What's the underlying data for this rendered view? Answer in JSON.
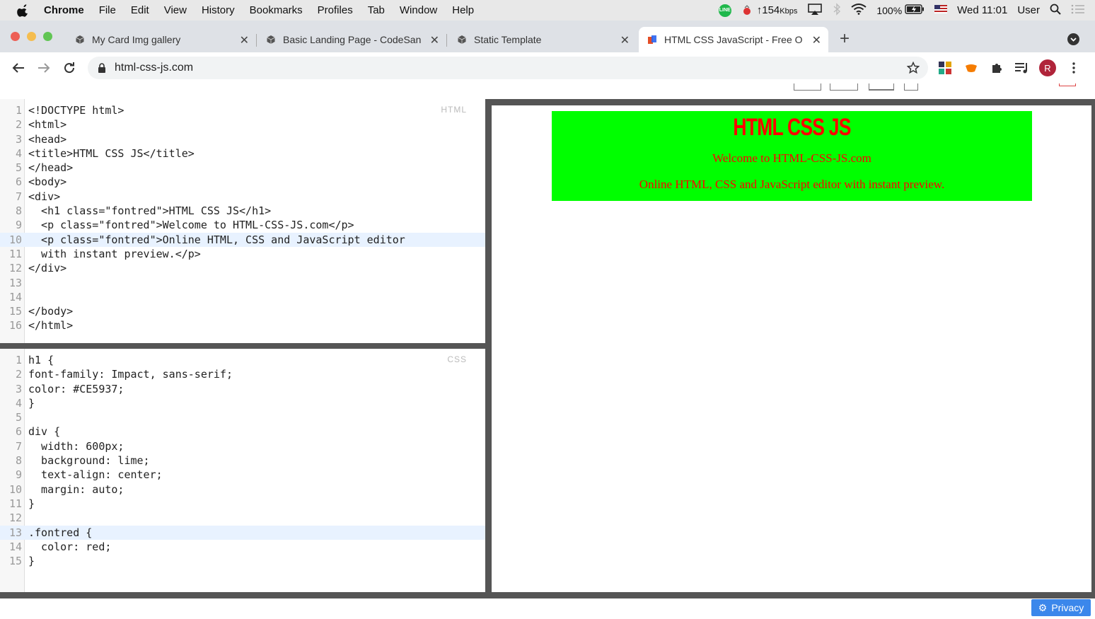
{
  "os_menubar": {
    "app_name": "Chrome",
    "items": [
      "File",
      "Edit",
      "View",
      "History",
      "Bookmarks",
      "Profiles",
      "Tab",
      "Window",
      "Help"
    ],
    "status": {
      "line_icon_text": "LINE",
      "network": "↑154",
      "network_unit": "Kbps",
      "battery": "100%",
      "datetime": "Wed 11:01",
      "user": "User"
    }
  },
  "browser": {
    "tabs": [
      {
        "title": "My Card Img gallery"
      },
      {
        "title": "Basic Landing Page - CodeSan"
      },
      {
        "title": "Static Template"
      },
      {
        "title": "HTML CSS JavaScript - Free O"
      }
    ],
    "url": "html-css-js.com",
    "profile_initial": "R"
  },
  "html_editor": {
    "lang_label": "HTML",
    "lines": [
      "<!DOCTYPE html>",
      "<html>",
      "<head>",
      "<title>HTML CSS JS</title>",
      "</head>",
      "<body>",
      "<div>",
      "  <h1 class=\"fontred\">HTML CSS JS</h1>",
      "  <p class=\"fontred\">Welcome to HTML-CSS-JS.com</p>",
      "  <p class=\"fontred\">Online HTML, CSS and JavaScript editor",
      "  with instant preview.</p>",
      "</div>",
      "",
      "",
      "</body>",
      "</html>"
    ]
  },
  "css_editor": {
    "lang_label": "CSS",
    "lines": [
      "h1 {",
      "font-family: Impact, sans-serif;",
      "color: #CE5937;",
      "}",
      "",
      "div {",
      "  width: 600px;",
      "  background: lime;",
      "  text-align: center;",
      "  margin: auto;",
      "}",
      "",
      ".fontred {",
      "  color: red;",
      "}"
    ]
  },
  "preview": {
    "heading": "HTML CSS JS",
    "paragraph1": "Welcome to HTML-CSS-JS.com",
    "paragraph2": "Online HTML, CSS and JavaScript editor with instant preview."
  },
  "privacy_label": "Privacy",
  "colors": {
    "preview_background": "#00ff00",
    "preview_text": "#ff0000",
    "active_line": "#e8f2ff"
  }
}
